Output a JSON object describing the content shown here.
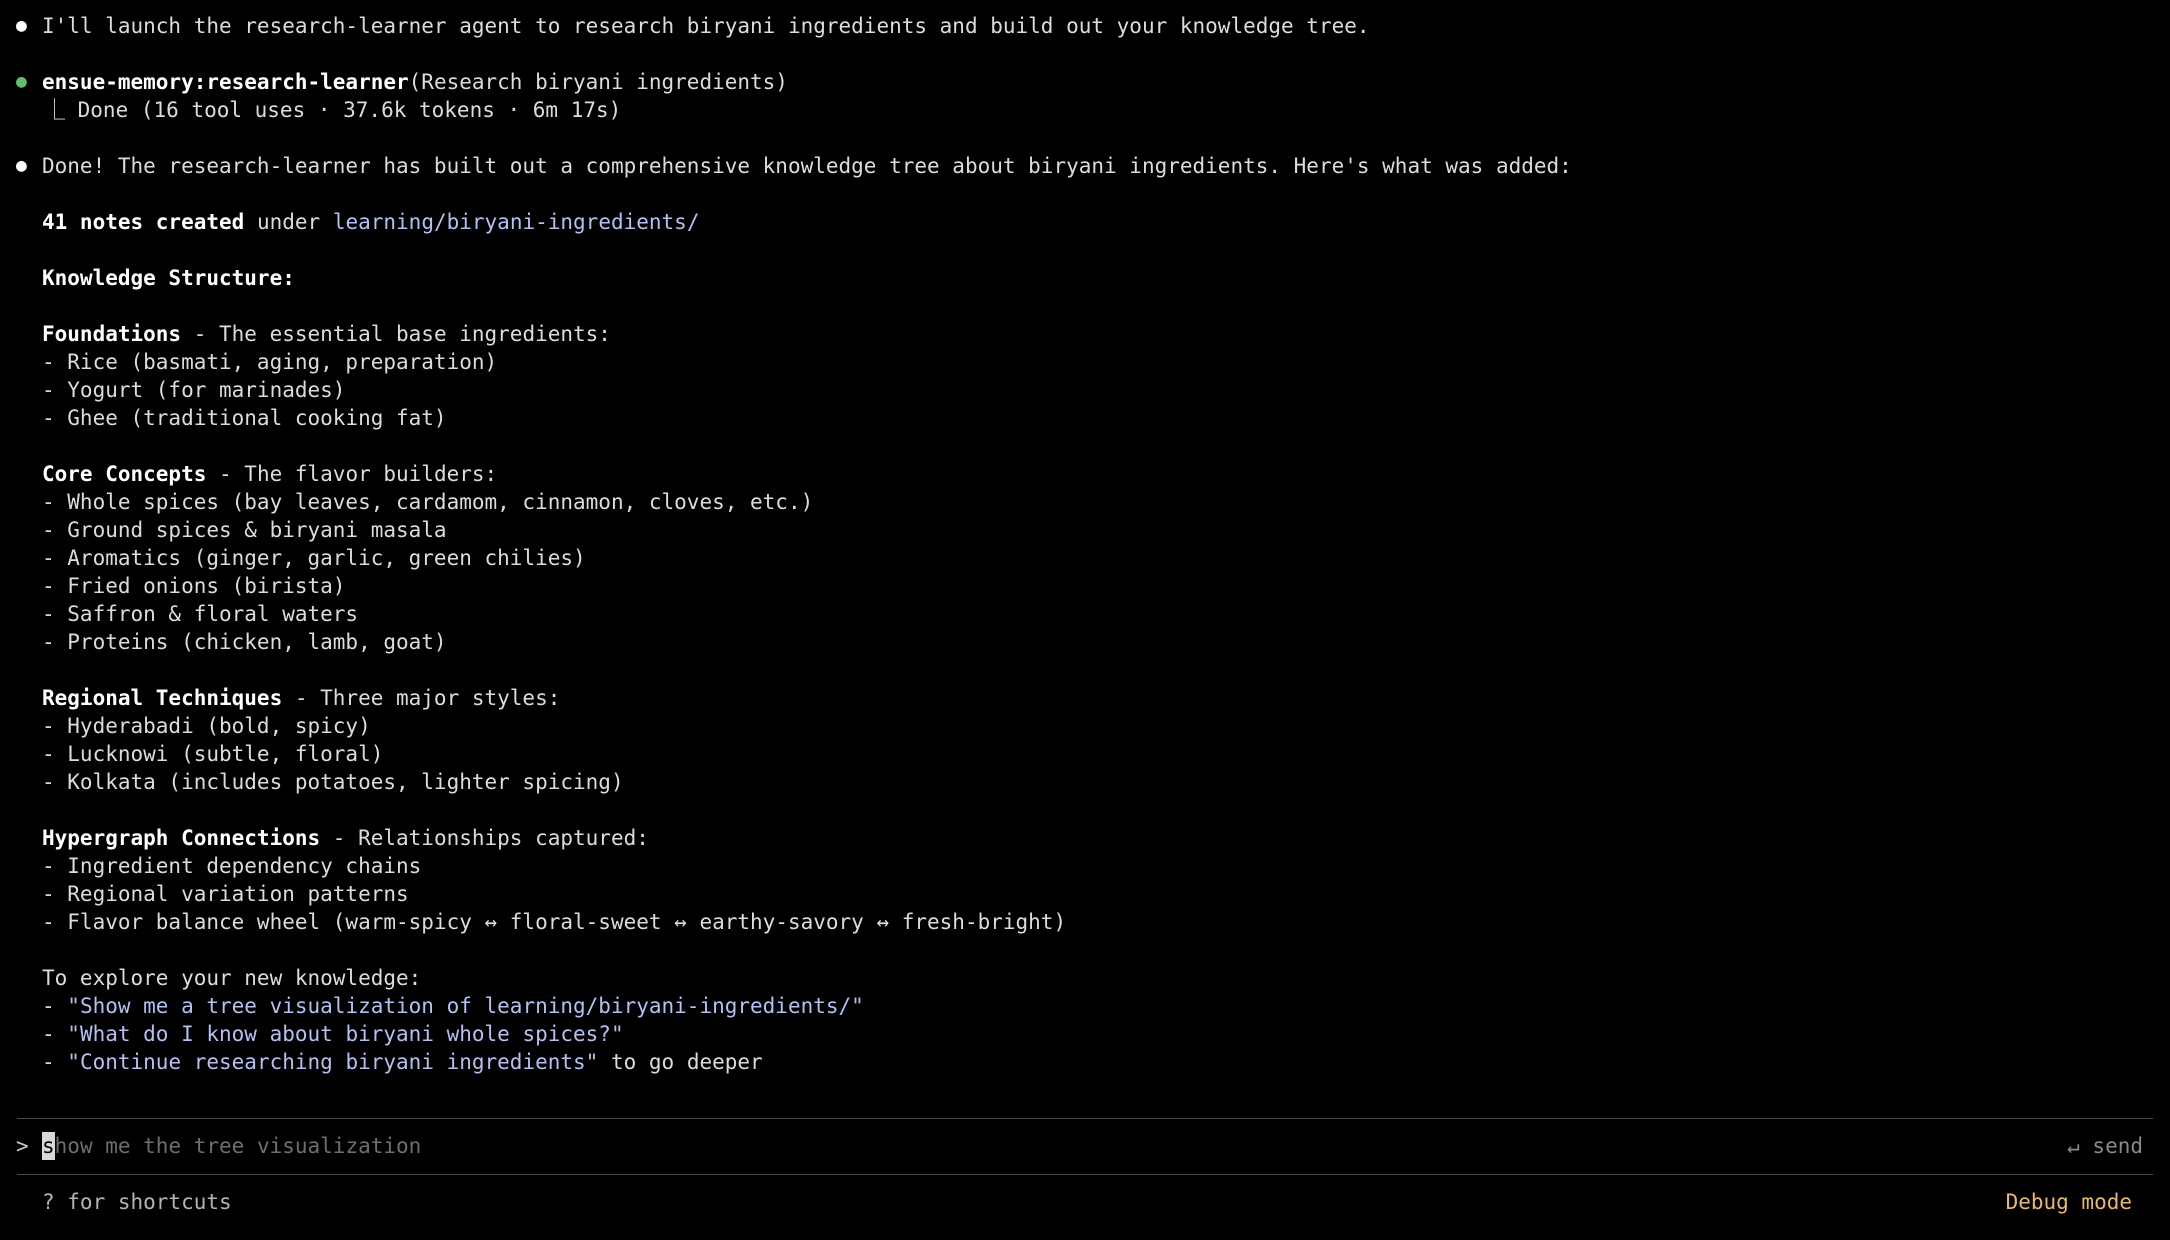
{
  "colors": {
    "background": "#000000",
    "text": "#dcdcdc",
    "link": "#b4c0f0",
    "status_dot_green": "#5fbf6a",
    "debug_mode": "#e8b96a"
  },
  "transcript": {
    "intro": "I'll launch the research-learner agent to research biryani ingredients and build out your knowledge tree.",
    "agent_name": "ensue-memory:research-learner",
    "agent_args": "(Research biryani ingredients)",
    "agent_result": "⎿ Done (16 tool uses · 37.6k tokens · 6m 17s)",
    "summary": "Done! The research-learner has built out a comprehensive knowledge tree about biryani ingredients. Here's what was added:",
    "notes_count": "41 notes created",
    "notes_under": " under ",
    "notes_path": "learning/biryani-ingredients/",
    "structure_heading": "Knowledge Structure:",
    "sections": {
      "foundations": {
        "title": "Foundations",
        "desc": " - The essential base ingredients:",
        "items": [
          "- Rice (basmati, aging, preparation)",
          "- Yogurt (for marinades)",
          "- Ghee (traditional cooking fat)"
        ]
      },
      "core": {
        "title": "Core Concepts",
        "desc": " - The flavor builders:",
        "items": [
          "- Whole spices (bay leaves, cardamom, cinnamon, cloves, etc.)",
          "- Ground spices & biryani masala",
          "- Aromatics (ginger, garlic, green chilies)",
          "- Fried onions (birista)",
          "- Saffron & floral waters",
          "- Proteins (chicken, lamb, goat)"
        ]
      },
      "regional": {
        "title": "Regional Techniques",
        "desc": " - Three major styles:",
        "items": [
          "- Hyderabadi (bold, spicy)",
          "- Lucknowi (subtle, floral)",
          "- Kolkata (includes potatoes, lighter spicing)"
        ]
      },
      "hypergraph": {
        "title": "Hypergraph Connections",
        "desc": " - Relationships captured:",
        "items": [
          "- Ingredient dependency chains",
          "- Regional variation patterns",
          "- Flavor balance wheel (warm-spicy ↔ floral-sweet ↔ earthy-savory ↔ fresh-bright)"
        ]
      }
    },
    "explore_heading": "To explore your new knowledge:",
    "explore": [
      {
        "dash": "- ",
        "quote": "\"Show me a tree visualization of learning/biryani-ingredients/\"",
        "suffix": ""
      },
      {
        "dash": "- ",
        "quote": "\"What do I know about biryani whole spices?\"",
        "suffix": ""
      },
      {
        "dash": "- ",
        "quote": "\"Continue researching biryani ingredients\"",
        "suffix": " to go deeper"
      }
    ]
  },
  "input": {
    "prompt": ">",
    "cursor_char": "s",
    "placeholder_rest": "how me the tree visualization",
    "send_label": "↵ send"
  },
  "footer": {
    "shortcuts": "? for shortcuts",
    "debug_mode": "Debug mode"
  }
}
